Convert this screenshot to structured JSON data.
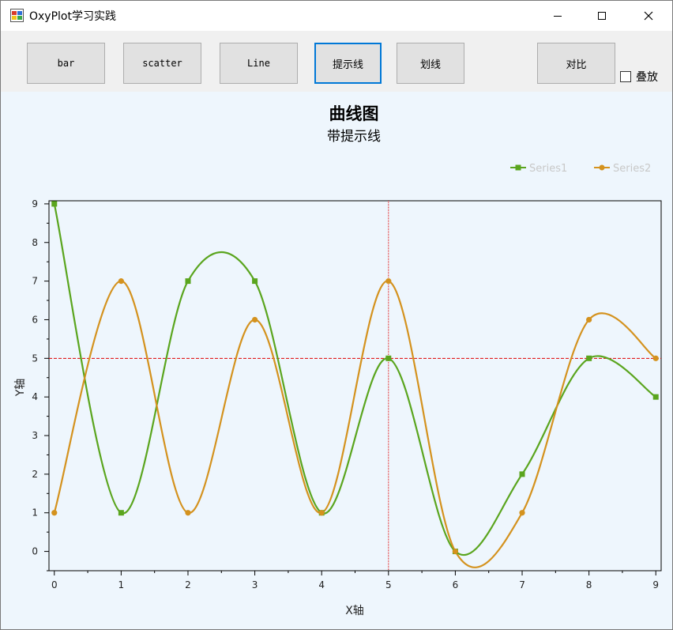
{
  "window": {
    "title": "OxyPlot学习实践"
  },
  "toolbar": {
    "buttons": [
      {
        "label": "bar"
      },
      {
        "label": "scatter"
      },
      {
        "label": "Line"
      },
      {
        "label": "提示线"
      },
      {
        "label": "划线"
      },
      {
        "label": "对比"
      }
    ],
    "checkbox_label": "叠放",
    "checkbox_checked": false
  },
  "chart_data": {
    "type": "line",
    "title": "曲线图",
    "subtitle": "带提示线",
    "xlabel": "X轴",
    "ylabel": "Y轴",
    "xlim": [
      -0.08,
      9.08
    ],
    "ylim": [
      -0.5,
      9.08
    ],
    "x_ticks": [
      "0",
      "1",
      "2",
      "3",
      "4",
      "5",
      "6",
      "7",
      "8",
      "9"
    ],
    "y_ticks": [
      "0",
      "1",
      "2",
      "3",
      "4",
      "5",
      "6",
      "7",
      "8",
      "9"
    ],
    "x": [
      0,
      1,
      2,
      3,
      4,
      5,
      6,
      7,
      8,
      9
    ],
    "series": [
      {
        "name": "Series1",
        "values": [
          9,
          1,
          7,
          7,
          1,
          5,
          0,
          2,
          5,
          4
        ],
        "color": "#5aa51e",
        "marker": "square"
      },
      {
        "name": "Series2",
        "values": [
          1,
          7,
          1,
          6,
          1,
          7,
          0,
          1,
          6,
          5
        ],
        "color": "#d4921e",
        "marker": "circle"
      }
    ],
    "smooth": true,
    "annotations": [
      {
        "type": "vertical-line",
        "x": 5,
        "color": "#e00000",
        "style": "dotted"
      },
      {
        "type": "horizontal-line",
        "y": 5,
        "color": "#e00000",
        "style": "dashed"
      }
    ],
    "legend_position": "top-right",
    "plot_background": "#eef6fd"
  }
}
